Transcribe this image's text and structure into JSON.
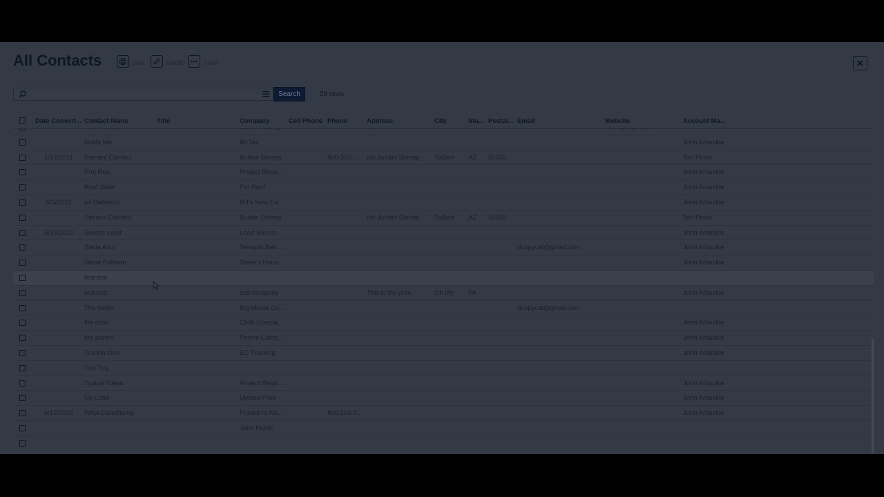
{
  "header": {
    "title": "All Contacts",
    "print_label": "print",
    "modify_label": "modify",
    "more_label": "more"
  },
  "search": {
    "placeholder": "",
    "button_label": "Search",
    "row_count": "58 rows"
  },
  "columns": [
    "Date Convert...",
    "Contact Name",
    "Title",
    "Company",
    "Cell Phone",
    "Phone",
    "Address",
    "City",
    "Sta...",
    "Postal...",
    "Email",
    "Website",
    "Account Ma..."
  ],
  "rows": [
    {
      "date": "",
      "name": "Not Primary",
      "company": "Bob Co Zinng",
      "phone": "",
      "address": "ahh",
      "city": "",
      "state": "",
      "postal": "",
      "email": "",
      "website": "www.google.com",
      "acct": ""
    },
    {
      "date": "",
      "name": "Notify Me",
      "company": "Bil Tax",
      "phone": "",
      "address": "",
      "city": "",
      "state": "",
      "postal": "",
      "email": "",
      "website": "",
      "acct": "John Arbuckle"
    },
    {
      "date": "1/17/2011",
      "name": "Primary Contact",
      "company": "Bubba Shrimp",
      "phone": "800-203-...",
      "address": "c/o Jumbo Shrimp",
      "city": "ToBein",
      "state": "AZ",
      "postal": "55555",
      "email": "",
      "website": "",
      "acct": "Tori Pinon"
    },
    {
      "date": "",
      "name": "Proj Req",
      "company": "Project Requ...",
      "phone": "",
      "address": "",
      "city": "",
      "state": "",
      "postal": "",
      "email": "",
      "website": "",
      "acct": "John Arbuckle"
    },
    {
      "date": "",
      "name": "Roof Sitter",
      "company": "For Roof",
      "phone": "",
      "address": "",
      "city": "",
      "state": "",
      "postal": "",
      "email": "",
      "website": "",
      "acct": "John Arbuckle"
    },
    {
      "date": "6/3/2015",
      "name": "sd DeMarco",
      "company": "Bill's New Ca...",
      "phone": "",
      "address": "",
      "city": "",
      "state": "",
      "postal": "",
      "email": "",
      "website": "",
      "acct": "John Arbuckle"
    },
    {
      "date": "",
      "name": "Second Contact",
      "company": "Bubba Shrimp",
      "phone": "",
      "address": "c/o Jumbo Shrimp",
      "city": "ToBein",
      "state": "AZ",
      "postal": "55555",
      "email": "",
      "website": "",
      "acct": "Tori Pinon"
    },
    {
      "date": "5/15/2012",
      "name": "Source Lead",
      "company": "Lead Source",
      "phone": "",
      "address": "",
      "city": "",
      "state": "",
      "postal": "",
      "email": "",
      "website": "",
      "acct": "John Arbuckle"
    },
    {
      "date": "",
      "name": "Stella Azul",
      "company": "Terrapin Bah...",
      "phone": "",
      "address": "",
      "city": "",
      "state": "",
      "postal": "",
      "email": "dcopycat@gmail.com",
      "website": "",
      "acct": "John Arbuckle"
    },
    {
      "date": "",
      "name": "Steve Fullmon",
      "company": "Steve's Hous...",
      "phone": "",
      "address": "",
      "city": "",
      "state": "",
      "postal": "",
      "email": "",
      "website": "",
      "acct": "John Arbuckle"
    },
    {
      "date": "",
      "name": "test test",
      "company": "",
      "phone": "",
      "address": "",
      "city": "",
      "state": "",
      "postal": "",
      "email": "",
      "website": "",
      "acct": "",
      "highlight": true
    },
    {
      "date": "",
      "name": "test test",
      "company": "test company",
      "phone": "",
      "address": "This is the print",
      "city": "Oh My",
      "state": "PA",
      "postal": "",
      "email": "",
      "website": "",
      "acct": "John Arbuckle"
    },
    {
      "date": "",
      "name": "The Seller",
      "company": "Big Media Co...",
      "phone": "",
      "address": "",
      "city": "",
      "state": "",
      "postal": "",
      "email": "dcopycat@gmail.com",
      "website": "",
      "acct": ""
    },
    {
      "date": "",
      "name": "the child",
      "company": "Child Compa...",
      "phone": "",
      "address": "",
      "city": "",
      "state": "",
      "postal": "",
      "email": "",
      "website": "",
      "acct": "John Arbuckle"
    },
    {
      "date": "",
      "name": "the parent",
      "company": "Parent Comp...",
      "phone": "",
      "address": "",
      "city": "",
      "state": "",
      "postal": "",
      "email": "",
      "website": "",
      "acct": "John Arbuckle"
    },
    {
      "date": "",
      "name": "Truckin One",
      "company": "EC Trucking",
      "phone": "",
      "address": "",
      "city": "",
      "state": "",
      "postal": "",
      "email": "",
      "website": "",
      "acct": "John Arbuckle"
    },
    {
      "date": "",
      "name": "Troj Troj",
      "company": "",
      "phone": "",
      "address": "",
      "city": "",
      "state": "",
      "postal": "",
      "email": "",
      "website": "",
      "acct": ""
    },
    {
      "date": "",
      "name": "Typical Client",
      "company": "Project Requ...",
      "phone": "",
      "address": "",
      "city": "",
      "state": "",
      "postal": "",
      "email": "",
      "website": "",
      "acct": "John Arbuckle"
    },
    {
      "date": "",
      "name": "Up Load",
      "company": "Upload Files",
      "phone": "",
      "address": "",
      "city": "",
      "state": "",
      "postal": "",
      "email": "",
      "website": "",
      "acct": "John Arbuckle"
    },
    {
      "date": "6/12/2015",
      "name": "What DateStamp",
      "company": "Franklin's No...",
      "phone": "800.203.7...",
      "address": "",
      "city": "",
      "state": "",
      "postal": "",
      "email": "",
      "website": "",
      "acct": "John Arbuckle"
    },
    {
      "date": "",
      "name": "",
      "company": "John Public",
      "phone": "",
      "address": "",
      "city": "",
      "state": "",
      "postal": "",
      "email": "",
      "website": "",
      "acct": ""
    },
    {
      "date": "",
      "name": "",
      "company": "",
      "phone": "",
      "address": "",
      "city": "",
      "state": "",
      "postal": "",
      "email": "",
      "website": "",
      "acct": ""
    }
  ]
}
